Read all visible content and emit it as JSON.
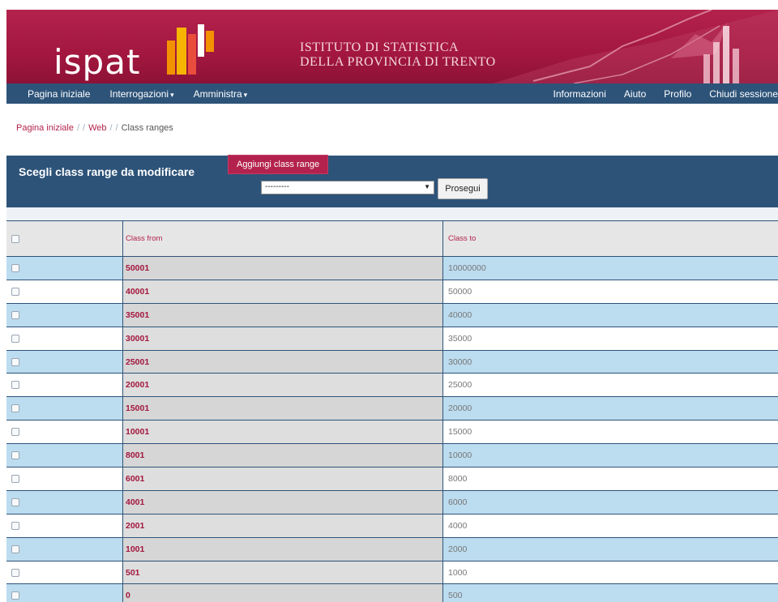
{
  "brand": {
    "logo_text": "ispat",
    "institute_line1": "ISTITUTO DI STATISTICA",
    "institute_line2": "DELLA PROVINCIA DI TRENTO",
    "primary_color": "#b3224d",
    "nav_color": "#2d5379"
  },
  "nav": {
    "home": "Pagina iniziale",
    "queries": "Interrogazioni",
    "admin": "Amministra",
    "info": "Informazioni",
    "help": "Aiuto",
    "profile": "Profilo",
    "logout": "Chiudi sessione"
  },
  "breadcrumb": {
    "home": "Pagina iniziale",
    "web": "Web",
    "current": "Class ranges",
    "separator": "/"
  },
  "panel": {
    "title": "Scegli class range da modificare",
    "add_button": "Aggiungi class range",
    "select_value": "---------",
    "go_button": "Prosegui"
  },
  "table": {
    "headers": {
      "from": "Class from",
      "to": "Class to"
    },
    "rows": [
      {
        "from": "50001",
        "to": "10000000"
      },
      {
        "from": "40001",
        "to": "50000"
      },
      {
        "from": "35001",
        "to": "40000"
      },
      {
        "from": "30001",
        "to": "35000"
      },
      {
        "from": "25001",
        "to": "30000"
      },
      {
        "from": "20001",
        "to": "25000"
      },
      {
        "from": "15001",
        "to": "20000"
      },
      {
        "from": "10001",
        "to": "15000"
      },
      {
        "from": "8001",
        "to": "10000"
      },
      {
        "from": "6001",
        "to": "8000"
      },
      {
        "from": "4001",
        "to": "6000"
      },
      {
        "from": "2001",
        "to": "4000"
      },
      {
        "from": "1001",
        "to": "2000"
      },
      {
        "from": "501",
        "to": "1000"
      },
      {
        "from": "0",
        "to": "500"
      }
    ]
  }
}
